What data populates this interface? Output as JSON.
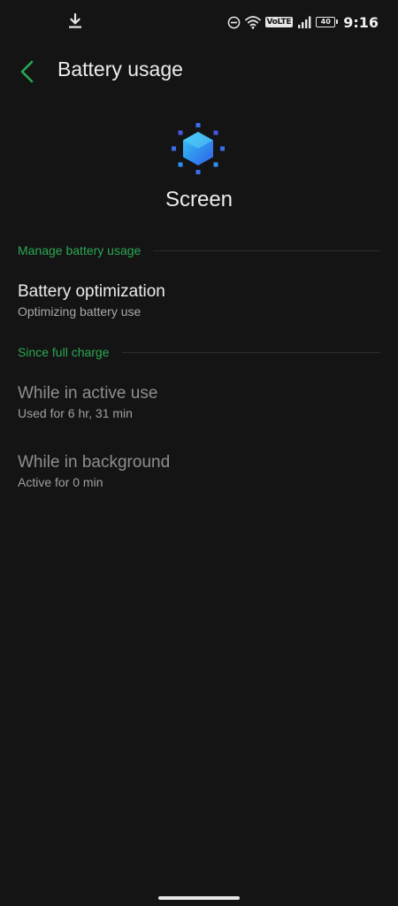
{
  "status_bar": {
    "time": "9:16",
    "network_label": "VoLTE",
    "battery_level": "40",
    "icons": [
      "download-icon",
      "do-not-disturb-icon",
      "wifi-icon",
      "volte-icon",
      "signal-icon",
      "battery-icon"
    ]
  },
  "header": {
    "title": "Battery usage",
    "back_icon": "back-arrow-icon"
  },
  "app": {
    "name": "Screen",
    "icon": "screen-brightness-icon"
  },
  "sections": {
    "manage": {
      "label": "Manage battery usage",
      "items": [
        {
          "title": "Battery optimization",
          "subtitle": "Optimizing battery use"
        }
      ]
    },
    "since_full_charge": {
      "label": "Since full charge",
      "items": [
        {
          "title": "While in active use",
          "subtitle": "Used for 6 hr, 31 min"
        },
        {
          "title": "While in background",
          "subtitle": "Active for 0 min"
        }
      ]
    }
  },
  "colors": {
    "background": "#141414",
    "accent": "#2aa854",
    "text_primary": "#ececec",
    "text_secondary": "#a8a8a8",
    "text_disabled": "#8e8e8e"
  }
}
